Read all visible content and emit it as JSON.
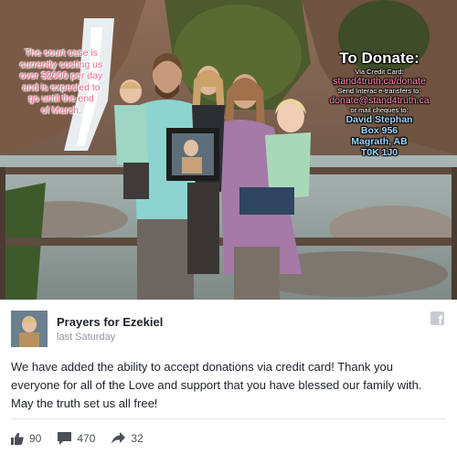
{
  "photo": {
    "left_overlay_lines": [
      "The court case is",
      "currently costing us",
      "over $2000 per day",
      "and is expected to",
      "go until the end",
      "of March."
    ],
    "right_overlay": {
      "heading": "To Donate:",
      "credit_label": "Via Credit Card:",
      "credit_url": "stand4truth.ca/donate",
      "interac_label": "Send Interac e-transfers to:",
      "interac_email": "donate@stand4truth.ca",
      "mail_label": "or mail cheques to:",
      "address_lines": [
        "David Stephan",
        "Box 956",
        "Magrath, AB",
        "T0K 1J0"
      ]
    }
  },
  "post": {
    "page_name": "Prayers for Ezekiel",
    "timestamp": "last Saturday",
    "message": "We have added the ability to accept donations via credit card! Thank you everyone for all of the Love and support that you have blessed our family with. May the truth set us all free!",
    "platform_icon": "facebook-icon"
  },
  "actions": {
    "likes": "90",
    "comments": "470",
    "shares": "32",
    "like_icon": "thumbs-up-icon",
    "comment_icon": "comment-bubble-icon",
    "share_icon": "share-arrow-icon"
  },
  "colors": {
    "left_overlay_text": "#f06a8c",
    "donate_link_pink": "#ff86b4",
    "address_blue": "#9ad8ff",
    "action_gray": "#4b4f56"
  }
}
